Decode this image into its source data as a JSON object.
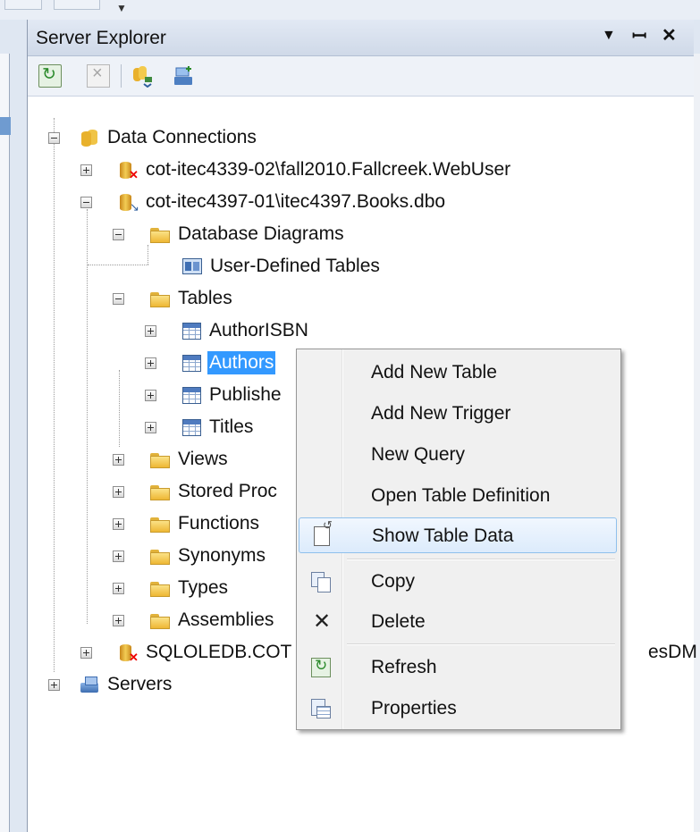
{
  "panel": {
    "title": "Server Explorer",
    "title_buttons": [
      {
        "name": "dropdown-arrow",
        "glyph": "▾"
      },
      {
        "name": "pin",
        "glyph": "ꟷ"
      },
      {
        "name": "close",
        "glyph": "✕"
      }
    ]
  },
  "toolbar": {
    "buttons": [
      "refresh-icon",
      "delete-icon",
      "connect-to-database-icon",
      "connect-to-server-icon"
    ]
  },
  "tree": {
    "data_connections": "Data Connections",
    "conn1": "cot-itec4339-02\\fall2010.Fallcreek.WebUser",
    "conn2": "cot-itec4397-01\\itec4397.Books.dbo",
    "database_diagrams": "Database Diagrams",
    "user_defined_tables": "User-Defined Tables",
    "tables": "Tables",
    "tables_list": [
      "AuthorISBN",
      "Authors",
      "Publishe",
      "Titles"
    ],
    "views": "Views",
    "stored_procedures": "Stored Proc",
    "functions": "Functions",
    "synonyms": "Synonyms",
    "types": "Types",
    "assemblies": "Assemblies",
    "conn3": "SQLOLEDB.COT",
    "conn3_tail": "esDM",
    "servers": "Servers"
  },
  "context_menu": {
    "items": [
      {
        "label": "Add New Table",
        "icon": ""
      },
      {
        "label": "Add New Trigger",
        "icon": ""
      },
      {
        "label": "New Query",
        "icon": ""
      },
      {
        "label": "Open Table Definition",
        "icon": ""
      },
      {
        "label": "Show Table Data",
        "icon": "show-table-data-icon",
        "highlighted": true
      },
      {
        "label": "Copy",
        "icon": "copy-icon"
      },
      {
        "label": "Delete",
        "icon": "delete-icon"
      },
      {
        "label": "Refresh",
        "icon": "refresh-icon"
      },
      {
        "label": "Properties",
        "icon": "properties-icon"
      }
    ]
  },
  "colors": {
    "selection": "#3399ff",
    "menu_highlight_border": "#8fc0ec"
  }
}
